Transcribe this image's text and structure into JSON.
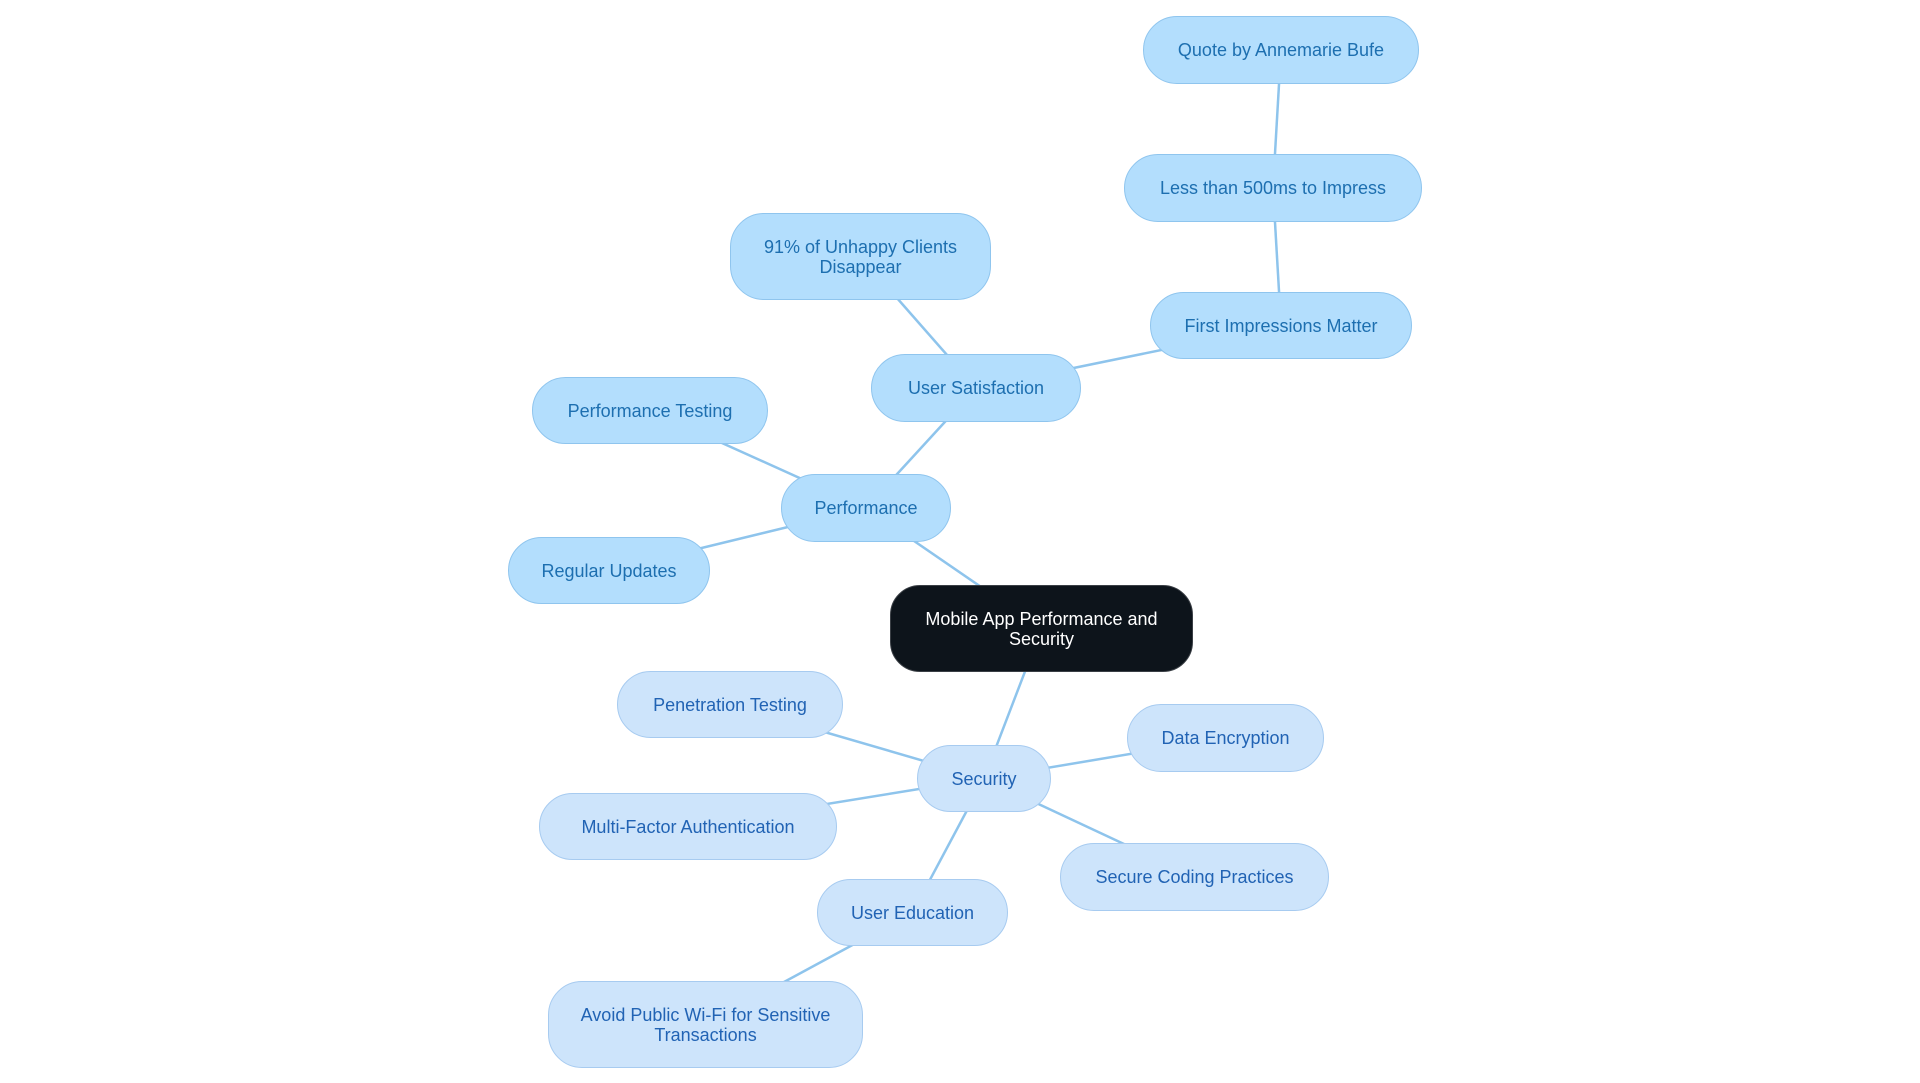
{
  "diagram": {
    "type": "mindmap",
    "colors": {
      "root_fill": "#0d141b",
      "root_text": "#ffffff",
      "performance_fill": "#b3defd",
      "performance_text": "#1d6fb0",
      "security_fill": "#cde4fb",
      "security_text": "#2163b4",
      "edge": "#8ec4ec"
    },
    "root": {
      "id": "root",
      "label": "Mobile App Performance and Security"
    },
    "nodes": [
      {
        "id": "performance",
        "label": "Performance",
        "parent": "root",
        "branch": "perf"
      },
      {
        "id": "user-satisfaction",
        "label": "User Satisfaction",
        "parent": "performance",
        "branch": "perf"
      },
      {
        "id": "unhappy-clients",
        "label": "91% of Unhappy Clients Disappear",
        "parent": "user-satisfaction",
        "branch": "perf"
      },
      {
        "id": "first-impressions",
        "label": "First Impressions Matter",
        "parent": "user-satisfaction",
        "branch": "perf"
      },
      {
        "id": "less-than-500ms",
        "label": "Less than 500ms to Impress",
        "parent": "first-impressions",
        "branch": "perf"
      },
      {
        "id": "quote-annemarie",
        "label": "Quote by Annemarie Bufe",
        "parent": "less-than-500ms",
        "branch": "perf"
      },
      {
        "id": "performance-testing",
        "label": "Performance Testing",
        "parent": "performance",
        "branch": "perf"
      },
      {
        "id": "regular-updates",
        "label": "Regular Updates",
        "parent": "performance",
        "branch": "perf"
      },
      {
        "id": "security",
        "label": "Security",
        "parent": "root",
        "branch": "sec"
      },
      {
        "id": "penetration-testing",
        "label": "Penetration Testing",
        "parent": "security",
        "branch": "sec"
      },
      {
        "id": "data-encryption",
        "label": "Data Encryption",
        "parent": "security",
        "branch": "sec"
      },
      {
        "id": "multi-factor-auth",
        "label": "Multi-Factor Authentication",
        "parent": "security",
        "branch": "sec"
      },
      {
        "id": "secure-coding",
        "label": "Secure Coding Practices",
        "parent": "security",
        "branch": "sec"
      },
      {
        "id": "user-education",
        "label": "User Education",
        "parent": "security",
        "branch": "sec"
      },
      {
        "id": "avoid-public-wifi",
        "label": "Avoid Public Wi-Fi for Sensitive Transactions",
        "parent": "user-education",
        "branch": "sec"
      }
    ]
  }
}
